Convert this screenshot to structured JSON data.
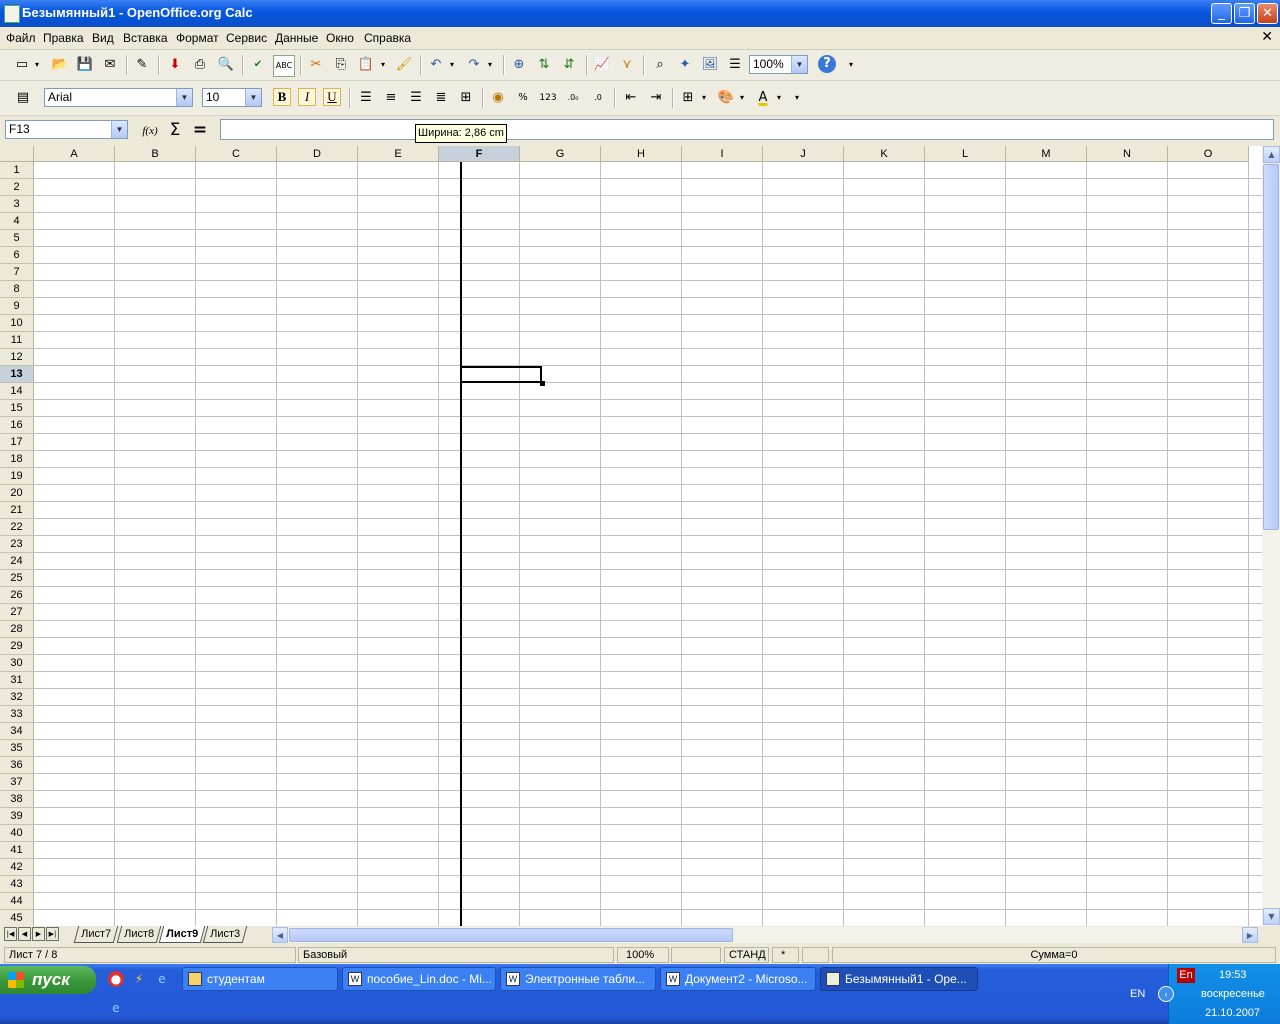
{
  "window": {
    "title": "Безымянный1 - OpenOffice.org Calc"
  },
  "menu": [
    "Файл",
    "Правка",
    "Вид",
    "Вставка",
    "Формат",
    "Сервис",
    "Данные",
    "Окно",
    "Справка"
  ],
  "toolbar": {
    "zoom": "100%"
  },
  "format_toolbar": {
    "font": "Arial",
    "size": "10"
  },
  "formula_bar": {
    "cell_ref": "F13",
    "content": "",
    "tooltip": "Ширина: 2,86 cm"
  },
  "grid": {
    "columns": [
      "A",
      "B",
      "C",
      "D",
      "E",
      "F",
      "G",
      "H",
      "I",
      "J",
      "K",
      "L",
      "M",
      "N",
      "O"
    ],
    "rows": [
      "1",
      "2",
      "3",
      "4",
      "5",
      "6",
      "7",
      "8",
      "9",
      "10",
      "11",
      "12",
      "13",
      "14",
      "15",
      "16",
      "17",
      "18",
      "19",
      "20",
      "21",
      "22",
      "23",
      "24",
      "25",
      "26",
      "27",
      "28",
      "29",
      "30",
      "31",
      "32",
      "33",
      "34",
      "35",
      "36",
      "37",
      "38",
      "39",
      "40",
      "41",
      "42",
      "43",
      "44",
      "45"
    ],
    "selected_column": "F",
    "selected_row": "13"
  },
  "sheets": {
    "tabs": [
      "Лист7",
      "Лист8",
      "Лист9",
      "Лист3"
    ],
    "active": "Лист9"
  },
  "status": {
    "sheet": "Лист 7 / 8",
    "style": "Базовый",
    "zoom": "100%",
    "mode": "СТАНД",
    "modified": "*",
    "sum": "Сумма=0"
  },
  "taskbar": {
    "start": "пуск",
    "tasks": [
      "студентам",
      "пособие_Lin.doc - Mi...",
      "Электронные табли...",
      "Документ2 - Microso...",
      "Безымянный1 - Ope..."
    ],
    "active_task": "Безымянный1 - Ope...",
    "lang": "EN",
    "lang_indicator": "En",
    "time": "19:53",
    "day": "воскресенье",
    "date": "21.10.2007"
  }
}
